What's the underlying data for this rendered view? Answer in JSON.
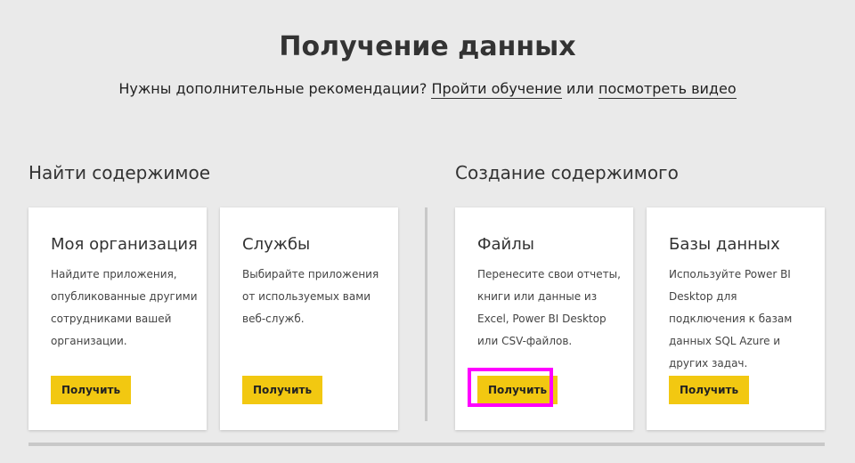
{
  "page": {
    "title": "Получение данных",
    "help_text": "Нужны дополнительные рекомендации?",
    "help_link_training": "Пройти обучение",
    "help_or": "или",
    "help_link_video": "посмотреть видео"
  },
  "sections": {
    "discover": {
      "heading": "Найти содержимое",
      "cards": [
        {
          "title": "Моя организация",
          "description": "Найдите приложения, опубликованные другими сотрудниками вашей организации.",
          "button": "Получить"
        },
        {
          "title": "Службы",
          "description": "Выбирайте приложения от используемых вами веб-служб.",
          "button": "Получить"
        }
      ]
    },
    "create": {
      "heading": "Создание содержимого",
      "cards": [
        {
          "title": "Файлы",
          "description": "Перенесите свои отчеты, книги или данные из Excel, Power BI Desktop или CSV-файлов.",
          "button": "Получить"
        },
        {
          "title": "Базы данных",
          "description": "Используйте Power BI Desktop для подключения к базам данных SQL Azure и других задач.",
          "button": "Получить"
        }
      ]
    }
  },
  "colors": {
    "background": "#eaeaea",
    "button": "#f2c811",
    "highlight": "#ff00ff",
    "card": "#ffffff"
  }
}
